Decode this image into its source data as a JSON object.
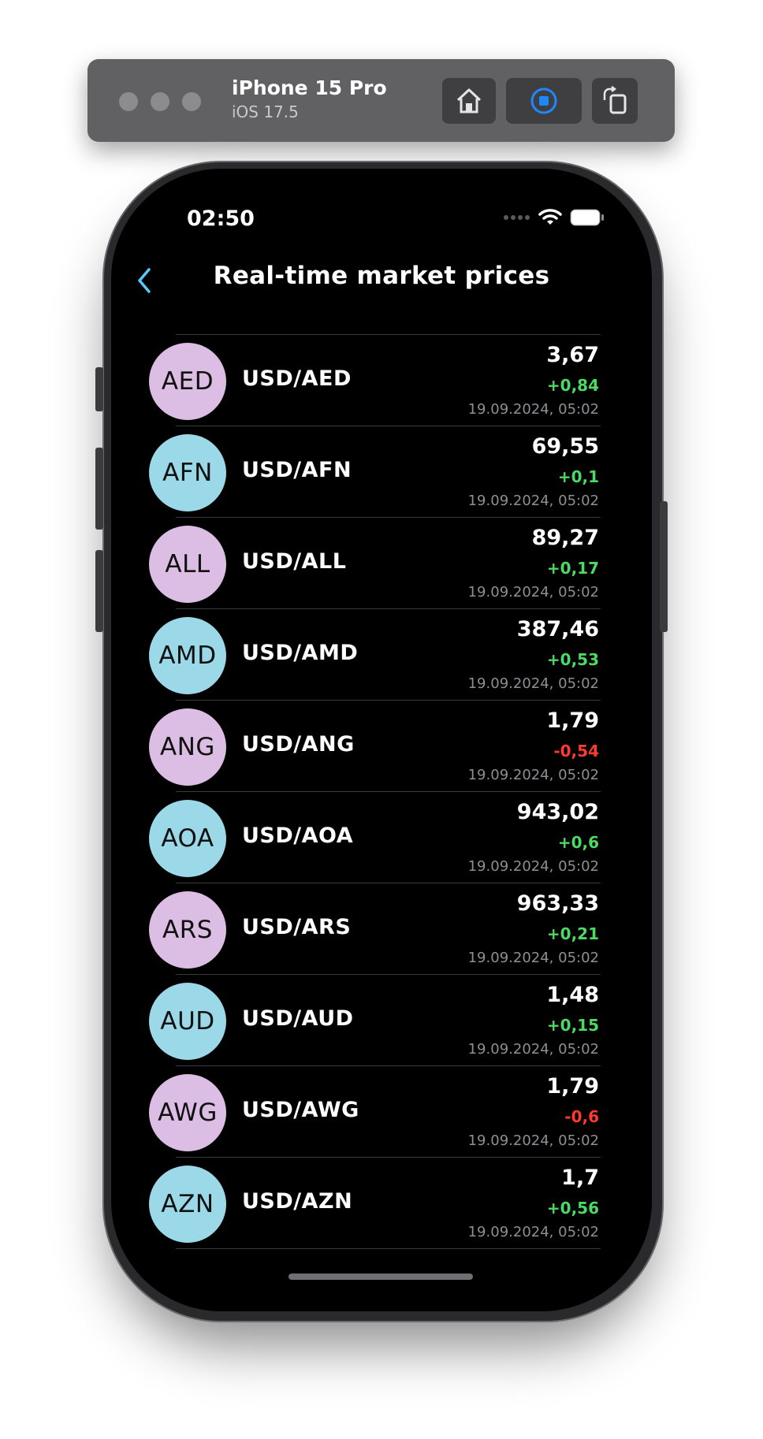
{
  "simulator": {
    "device_name": "iPhone 15 Pro",
    "os_version": "iOS 17.5"
  },
  "status_bar": {
    "time": "02:50"
  },
  "nav": {
    "title": "Real-time market prices"
  },
  "colors": {
    "accent": "#5ac8fa",
    "positive": "#4cd964",
    "negative": "#ff3b30",
    "badge_purple": "#dcbde3",
    "badge_blue": "#9bd8e8"
  },
  "rates": [
    {
      "code": "AED",
      "pair": "USD/AED",
      "price": "3,67",
      "change": "+0,84",
      "direction": "up",
      "timestamp": "19.09.2024, 05:02",
      "badge_color": "#dcbde3"
    },
    {
      "code": "AFN",
      "pair": "USD/AFN",
      "price": "69,55",
      "change": "+0,1",
      "direction": "up",
      "timestamp": "19.09.2024, 05:02",
      "badge_color": "#9bd8e8"
    },
    {
      "code": "ALL",
      "pair": "USD/ALL",
      "price": "89,27",
      "change": "+0,17",
      "direction": "up",
      "timestamp": "19.09.2024, 05:02",
      "badge_color": "#dcbde3"
    },
    {
      "code": "AMD",
      "pair": "USD/AMD",
      "price": "387,46",
      "change": "+0,53",
      "direction": "up",
      "timestamp": "19.09.2024, 05:02",
      "badge_color": "#9bd8e8"
    },
    {
      "code": "ANG",
      "pair": "USD/ANG",
      "price": "1,79",
      "change": "-0,54",
      "direction": "down",
      "timestamp": "19.09.2024, 05:02",
      "badge_color": "#dcbde3"
    },
    {
      "code": "AOA",
      "pair": "USD/AOA",
      "price": "943,02",
      "change": "+0,6",
      "direction": "up",
      "timestamp": "19.09.2024, 05:02",
      "badge_color": "#9bd8e8"
    },
    {
      "code": "ARS",
      "pair": "USD/ARS",
      "price": "963,33",
      "change": "+0,21",
      "direction": "up",
      "timestamp": "19.09.2024, 05:02",
      "badge_color": "#dcbde3"
    },
    {
      "code": "AUD",
      "pair": "USD/AUD",
      "price": "1,48",
      "change": "+0,15",
      "direction": "up",
      "timestamp": "19.09.2024, 05:02",
      "badge_color": "#9bd8e8"
    },
    {
      "code": "AWG",
      "pair": "USD/AWG",
      "price": "1,79",
      "change": "-0,6",
      "direction": "down",
      "timestamp": "19.09.2024, 05:02",
      "badge_color": "#dcbde3"
    },
    {
      "code": "AZN",
      "pair": "USD/AZN",
      "price": "1,7",
      "change": "+0,56",
      "direction": "up",
      "timestamp": "19.09.2024, 05:02",
      "badge_color": "#9bd8e8"
    }
  ]
}
